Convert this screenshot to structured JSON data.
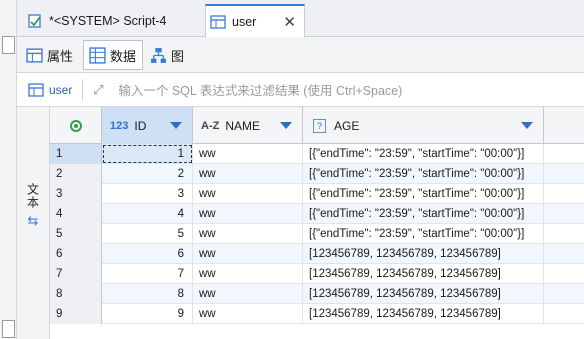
{
  "tabs": [
    {
      "label": "*<SYSTEM> Script-4"
    },
    {
      "label": "user"
    }
  ],
  "subtabs": {
    "properties": "属性",
    "data": "数据",
    "diagram": "图"
  },
  "filter": {
    "table_label": "user",
    "placeholder": "输入一个 SQL 表达式来过滤结果 (使用 Ctrl+Space)"
  },
  "side_tools": {
    "grid_label": "网格",
    "text_label": "文本"
  },
  "columns": [
    {
      "type": "123",
      "name": "ID"
    },
    {
      "type": "A-Z",
      "name": "NAME"
    },
    {
      "type": "?",
      "name": "AGE"
    }
  ],
  "rows": [
    {
      "rn": "1",
      "id": "1",
      "name": "ww",
      "age": "[{\"endTime\": \"23:59\", \"startTime\": \"00:00\"}]"
    },
    {
      "rn": "2",
      "id": "2",
      "name": "ww",
      "age": "[{\"endTime\": \"23:59\", \"startTime\": \"00:00\"}]"
    },
    {
      "rn": "3",
      "id": "3",
      "name": "ww",
      "age": "[{\"endTime\": \"23:59\", \"startTime\": \"00:00\"}]"
    },
    {
      "rn": "4",
      "id": "4",
      "name": "ww",
      "age": "[{\"endTime\": \"23:59\", \"startTime\": \"00:00\"}]"
    },
    {
      "rn": "5",
      "id": "5",
      "name": "ww",
      "age": "[{\"endTime\": \"23:59\", \"startTime\": \"00:00\"}]"
    },
    {
      "rn": "6",
      "id": "6",
      "name": "ww",
      "age": "[123456789, 123456789, 123456789]"
    },
    {
      "rn": "7",
      "id": "7",
      "name": "ww",
      "age": "[123456789, 123456789, 123456789]"
    },
    {
      "rn": "8",
      "id": "8",
      "name": "ww",
      "age": "[123456789, 123456789, 123456789]"
    },
    {
      "rn": "9",
      "id": "9",
      "name": "ww",
      "age": "[123456789, 123456789, 123456789]"
    }
  ],
  "colors": {
    "accent": "#2f7ed8",
    "selected_row": "#cfe0f5",
    "alt_row": "#f2f7fd"
  }
}
